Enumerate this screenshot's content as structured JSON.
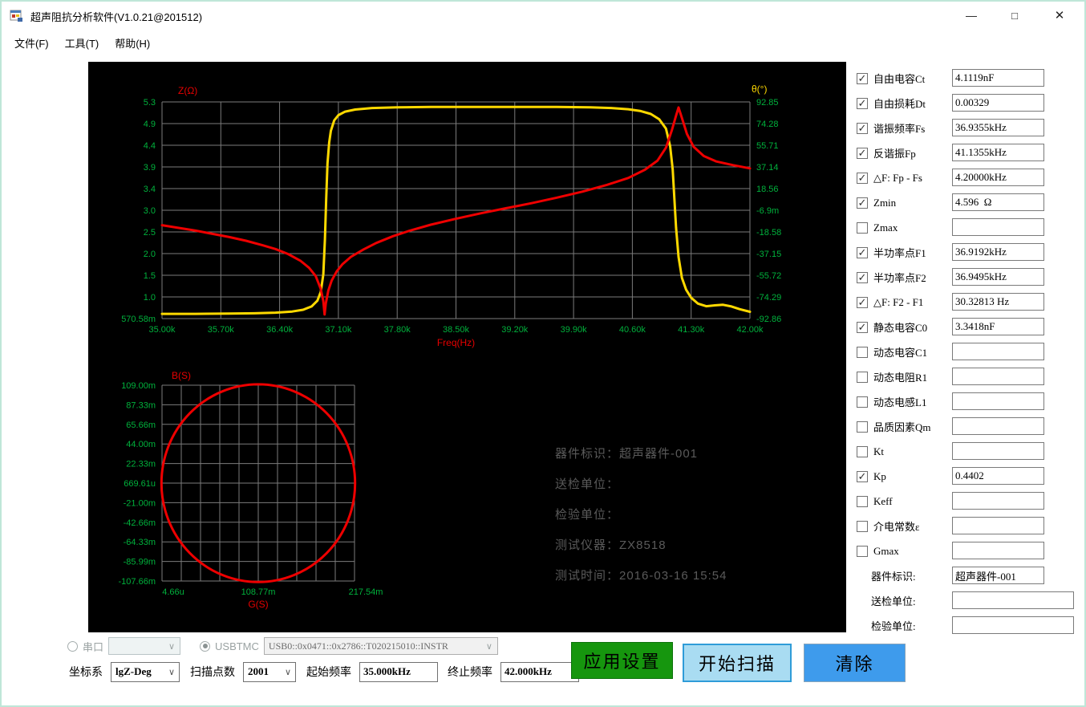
{
  "window": {
    "title": "超声阻抗分析软件(V1.0.21@201512)",
    "controls": {
      "minimize": "—",
      "maximize": "□",
      "close": "✕"
    }
  },
  "menu": {
    "items": [
      {
        "label": "文件(F)"
      },
      {
        "label": "工具(T)"
      },
      {
        "label": "帮助(H)"
      }
    ]
  },
  "icons": {
    "check_glyph": "✓",
    "chevron_glyph": "∨"
  },
  "device_info": {
    "lines": [
      {
        "label": "器件标识：",
        "value": "超声器件-001"
      },
      {
        "label": "送检单位：",
        "value": ""
      },
      {
        "label": "检验单位：",
        "value": ""
      },
      {
        "label": "测试仪器：",
        "value": "ZX8518"
      },
      {
        "label": "测试时间：",
        "value": "2016-03-16 15:54"
      }
    ]
  },
  "params": [
    {
      "label": "自由电容Ct",
      "checked": true,
      "value": "4.1119nF"
    },
    {
      "label": "自由损耗Dt",
      "checked": true,
      "value": "0.00329"
    },
    {
      "label": "谐振频率Fs",
      "checked": true,
      "value": "36.9355kHz"
    },
    {
      "label": "反谐振Fp",
      "checked": true,
      "value": "41.1355kHz"
    },
    {
      "label": "△F: Fp - Fs",
      "checked": true,
      "value": "4.20000kHz"
    },
    {
      "label": "Zmin",
      "checked": true,
      "value": "4.596  Ω"
    },
    {
      "label": "Zmax",
      "checked": false,
      "value": ""
    },
    {
      "label": "半功率点F1",
      "checked": true,
      "value": "36.9192kHz"
    },
    {
      "label": "半功率点F2",
      "checked": true,
      "value": "36.9495kHz"
    },
    {
      "label": "△F: F2 - F1",
      "checked": true,
      "value": "30.32813 Hz"
    },
    {
      "label": "静态电容C0",
      "checked": true,
      "value": "3.3418nF"
    },
    {
      "label": "动态电容C1",
      "checked": false,
      "value": ""
    },
    {
      "label": "动态电阻R1",
      "checked": false,
      "value": ""
    },
    {
      "label": "动态电感L1",
      "checked": false,
      "value": ""
    },
    {
      "label": "品质因素Qm",
      "checked": false,
      "value": ""
    },
    {
      "label": "Kt",
      "checked": false,
      "value": ""
    },
    {
      "label": "Kp",
      "checked": true,
      "value": "0.4402"
    },
    {
      "label": "Keff",
      "checked": false,
      "value": ""
    },
    {
      "label": "介电常数ε",
      "checked": false,
      "value": ""
    },
    {
      "label": "Gmax",
      "checked": false,
      "value": ""
    }
  ],
  "identity_fields": [
    {
      "label": "器件标识:",
      "value": "超声器件-001",
      "wide": false
    },
    {
      "label": "送检单位:",
      "value": "",
      "wide": true
    },
    {
      "label": "检验单位:",
      "value": "",
      "wide": true
    }
  ],
  "connection": {
    "serial_radio_label": "串口",
    "serial_selected": false,
    "serial_port_value": "",
    "usbtmc_radio_label": "USBTMC",
    "usbtmc_selected": true,
    "usbtmc_address": "USB0::0x0471::0x2786::T020215010::INSTR"
  },
  "sweep_settings": {
    "coord_label": "坐标系",
    "coord_value": "lgZ-Deg",
    "points_label": "扫描点数",
    "points_value": "2001",
    "start_label": "起始频率",
    "start_value": "35.000kHz",
    "stop_label": "终止频率",
    "stop_value": "42.000kHz"
  },
  "buttons": {
    "apply": "应用设置",
    "start": "开始扫描",
    "clear": "清除"
  },
  "colors": {
    "plot_bg": "#000000",
    "grid": "#7b7b7b",
    "tick_green": "#00b13c",
    "axis_red": "#e60000",
    "curve_red": "#ee0000",
    "curve_yellow": "#ffd900",
    "info_gray": "#5a5a5a",
    "apply_btn_bg": "#16960e",
    "start_btn_bg": "#a9dcf2",
    "clear_btn_bg": "#3e9bec",
    "window_border": "#bfe6d8"
  },
  "chart_data": [
    {
      "type": "line",
      "title": "impedance and phase vs frequency",
      "x_label": "Freq(Hz)",
      "y_left_label": "Z(Ω)",
      "y_right_label": "θ(°)",
      "x_range_khz": [
        35.0,
        42.0
      ],
      "y_left_range_log10_ohm": [
        0.57058,
        5.3
      ],
      "y_right_range_deg": [
        -92.86,
        92.85
      ],
      "x_ticks": [
        "35.00k",
        "35.70k",
        "36.40k",
        "37.10k",
        "37.80k",
        "38.50k",
        "39.20k",
        "39.90k",
        "40.60k",
        "41.30k",
        "42.00k"
      ],
      "y_left_ticks": [
        "5.3",
        "4.9",
        "4.4",
        "3.9",
        "3.4",
        "3.0",
        "2.5",
        "2.0",
        "1.5",
        "1.0",
        "570.58m"
      ],
      "y_right_ticks": [
        "92.85",
        "74.28",
        "55.71",
        "37.14",
        "18.56",
        "-6.9m",
        "-18.58",
        "-37.15",
        "-55.72",
        "-74.29",
        "-92.86"
      ],
      "grid": true,
      "series": [
        {
          "name": "phase_deg",
          "axis": "right",
          "color": "#ffd900",
          "points": [
            [
              35.0,
              -88.8
            ],
            [
              35.4,
              -88.8
            ],
            [
              35.8,
              -88.6
            ],
            [
              36.1,
              -88.3
            ],
            [
              36.35,
              -87.8
            ],
            [
              36.55,
              -86.8
            ],
            [
              36.68,
              -85.3
            ],
            [
              36.78,
              -82.5
            ],
            [
              36.85,
              -77.5
            ],
            [
              36.89,
              -70
            ],
            [
              36.92,
              -55
            ],
            [
              36.94,
              -25
            ],
            [
              36.955,
              10
            ],
            [
              36.97,
              40
            ],
            [
              36.99,
              58
            ],
            [
              37.01,
              68
            ],
            [
              37.05,
              77
            ],
            [
              37.1,
              81.5
            ],
            [
              37.18,
              84.5
            ],
            [
              37.3,
              86.3
            ],
            [
              37.5,
              87.6
            ],
            [
              37.8,
              88.2
            ],
            [
              38.2,
              88.5
            ],
            [
              38.7,
              88.6
            ],
            [
              39.2,
              88.6
            ],
            [
              39.7,
              88.5
            ],
            [
              40.1,
              88.2
            ],
            [
              40.35,
              87.6
            ],
            [
              40.55,
              86.6
            ],
            [
              40.7,
              85
            ],
            [
              40.82,
              82.5
            ],
            [
              40.92,
              78
            ],
            [
              41.0,
              70
            ],
            [
              41.05,
              55
            ],
            [
              41.08,
              35
            ],
            [
              41.1,
              10
            ],
            [
              41.12,
              -15
            ],
            [
              41.15,
              -40
            ],
            [
              41.19,
              -58
            ],
            [
              41.24,
              -68
            ],
            [
              41.3,
              -75
            ],
            [
              41.38,
              -80
            ],
            [
              41.48,
              -82.3
            ],
            [
              41.58,
              -81.5
            ],
            [
              41.68,
              -81
            ],
            [
              41.78,
              -82.5
            ],
            [
              41.88,
              -84.8
            ],
            [
              42.0,
              -87
            ]
          ]
        },
        {
          "name": "impedance_log10_ohm",
          "axis": "left",
          "color": "#ee0000",
          "points": [
            [
              35.0,
              2.61
            ],
            [
              35.2,
              2.55
            ],
            [
              35.4,
              2.49
            ],
            [
              35.6,
              2.42
            ],
            [
              35.8,
              2.35
            ],
            [
              36.0,
              2.27
            ],
            [
              36.2,
              2.17
            ],
            [
              36.35,
              2.09
            ],
            [
              36.5,
              1.98
            ],
            [
              36.65,
              1.83
            ],
            [
              36.75,
              1.68
            ],
            [
              36.83,
              1.5
            ],
            [
              36.89,
              1.22
            ],
            [
              36.92,
              0.95
            ],
            [
              36.9355,
              0.66
            ],
            [
              36.95,
              0.9
            ],
            [
              36.98,
              1.18
            ],
            [
              37.02,
              1.4
            ],
            [
              37.08,
              1.6
            ],
            [
              37.15,
              1.76
            ],
            [
              37.25,
              1.92
            ],
            [
              37.4,
              2.08
            ],
            [
              37.55,
              2.22
            ],
            [
              37.75,
              2.37
            ],
            [
              37.95,
              2.49
            ],
            [
              38.2,
              2.62
            ],
            [
              38.5,
              2.75
            ],
            [
              38.8,
              2.87
            ],
            [
              39.1,
              2.98
            ],
            [
              39.4,
              3.09
            ],
            [
              39.7,
              3.21
            ],
            [
              40.0,
              3.34
            ],
            [
              40.3,
              3.49
            ],
            [
              40.55,
              3.64
            ],
            [
              40.75,
              3.82
            ],
            [
              40.9,
              4.02
            ],
            [
              41.0,
              4.3
            ],
            [
              41.07,
              4.68
            ],
            [
              41.12,
              5.0
            ],
            [
              41.15,
              5.18
            ],
            [
              41.19,
              4.95
            ],
            [
              41.25,
              4.6
            ],
            [
              41.33,
              4.32
            ],
            [
              41.45,
              4.12
            ],
            [
              41.6,
              4.0
            ],
            [
              41.8,
              3.92
            ],
            [
              42.0,
              3.85
            ]
          ]
        }
      ]
    },
    {
      "type": "line",
      "title": "admittance circle B(S) vs G(S)",
      "x_label": "G(S)",
      "y_label": "B(S)",
      "x_range_siemens": [
        4.66e-06,
        0.21754
      ],
      "y_range_siemens": [
        -0.10766,
        0.109
      ],
      "x_ticks": [
        "4.66u",
        "108.77m",
        "217.54m"
      ],
      "y_ticks": [
        "109.00m",
        "87.33m",
        "65.66m",
        "44.00m",
        "22.33m",
        "669.61u",
        "-21.00m",
        "-42.66m",
        "-64.33m",
        "-85.99m",
        "-107.66m"
      ],
      "grid": true,
      "circle": {
        "cx": 0.1088,
        "cy": 0.0006,
        "r": 0.1094,
        "color": "#ee0000"
      }
    }
  ]
}
